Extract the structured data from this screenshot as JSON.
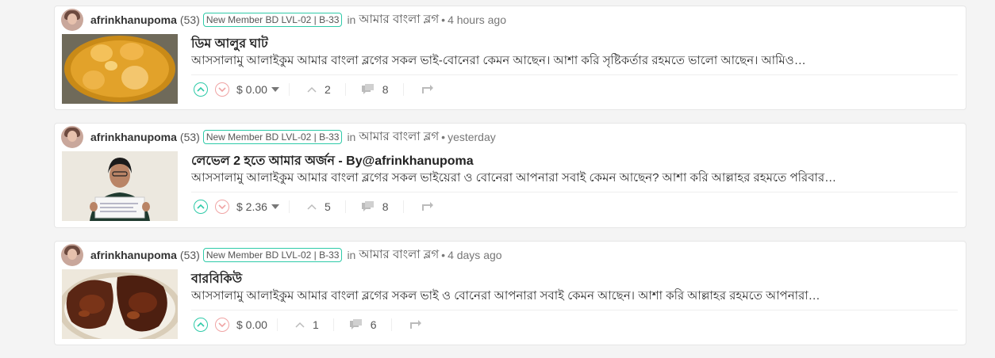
{
  "posts": [
    {
      "author": "afrinkhanupoma",
      "reputation": "(53)",
      "badge": "New Member BD LVL-02 | B-33",
      "in_label": "in",
      "community": "আমার বাংলা ব্লগ",
      "dot": "•",
      "time": "4 hours ago",
      "title": "ডিম আলুর ঘাট",
      "excerpt": "আসসালামু আলাইকুম আমার বাংলা ব্লগের সকল ভাই-বোনেরা কেমন আছেন। আশা করি সৃষ্টিকর্তার রহমতে ভালো আছেন। আমিও…",
      "payout": "$ 0.00",
      "votes": "2",
      "comments": "8",
      "thumb": "egg-curry"
    },
    {
      "author": "afrinkhanupoma",
      "reputation": "(53)",
      "badge": "New Member BD LVL-02 | B-33",
      "in_label": "in",
      "community": "আমার বাংলা ব্লগ",
      "dot": "•",
      "time": "yesterday",
      "title": "লেভেল 2 হতে আমার অর্জন - By@afrinkhanupoma",
      "excerpt": "আসসালামু আলাইকুম আমার বাংলা ব্লগের সকল ভাইয়েরা ও বোনেরা আপনারা সবাই কেমন আছেন? আশা করি আল্লাহর রহমতে পরিবার…",
      "payout": "$ 2.36",
      "votes": "5",
      "comments": "8",
      "thumb": "person-holding-paper"
    },
    {
      "author": "afrinkhanupoma",
      "reputation": "(53)",
      "badge": "New Member BD LVL-02 | B-33",
      "in_label": "in",
      "community": "আমার বাংলা ব্লগ",
      "dot": "•",
      "time": "4 days ago",
      "title": "বারবিকিউ",
      "excerpt": "আসসালামু আলাইকুম আমার বাংলা ব্লগের সকল ভাই ও বোনেরা আপনারা সবাই কেমন আছেন। আশা করি আল্লাহর রহমতে আপনারা…",
      "payout": "$ 0.00",
      "votes": "1",
      "comments": "6",
      "thumb": "barbecue-chicken"
    }
  ],
  "icons": {
    "upvote": "chevron-up-circle-icon",
    "downvote": "chevron-down-circle-icon",
    "votes": "chevron-up-icon",
    "comments": "comments-icon",
    "reblog": "reblog-icon"
  },
  "colors": {
    "accent": "#2ecaa8",
    "downvote": "#f0a4a4"
  }
}
